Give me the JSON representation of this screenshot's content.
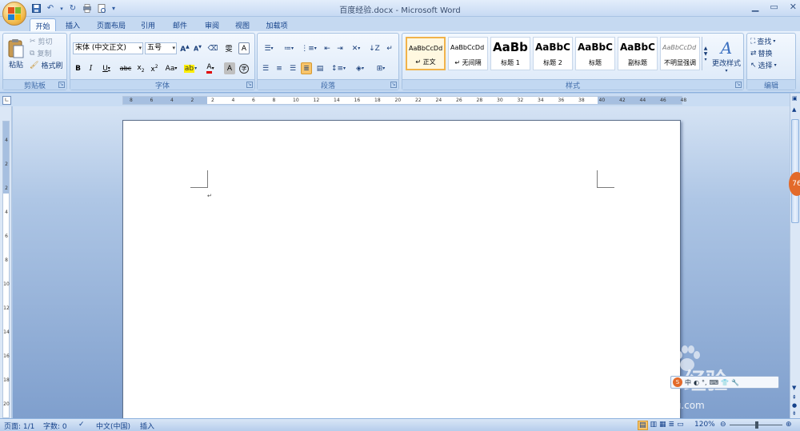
{
  "window": {
    "title": "百度经验.docx - Microsoft Word"
  },
  "tabs": [
    {
      "label": "开始",
      "active": true
    },
    {
      "label": "插入"
    },
    {
      "label": "页面布局"
    },
    {
      "label": "引用"
    },
    {
      "label": "邮件"
    },
    {
      "label": "审阅"
    },
    {
      "label": "视图"
    },
    {
      "label": "加载项"
    }
  ],
  "clipboard": {
    "paste": "粘贴",
    "cut": "剪切",
    "copy": "复制",
    "format_painter": "格式刷",
    "label": "剪贴板"
  },
  "font": {
    "name": "宋体 (中文正文)",
    "size": "五号",
    "label": "字体",
    "aa_label": "Aa"
  },
  "paragraph": {
    "label": "段落"
  },
  "styles": {
    "label": "样式",
    "items": [
      {
        "sample": "AaBbCcDd",
        "name": "↵ 正文",
        "selected": true
      },
      {
        "sample": "AaBbCcDd",
        "name": "↵ 无间隔"
      },
      {
        "sample": "AaBb",
        "name": "标题 1"
      },
      {
        "sample": "AaBbC",
        "name": "标题 2"
      },
      {
        "sample": "AaBbC",
        "name": "标题"
      },
      {
        "sample": "AaBbC",
        "name": "副标题"
      },
      {
        "sample": "AaBbCcDd",
        "name": "不明显强调"
      }
    ],
    "change_styles": "更改样式"
  },
  "editing": {
    "find": "查找",
    "replace": "替换",
    "select": "选择",
    "label": "编辑"
  },
  "document": {
    "cursor_mark": "↵"
  },
  "ruler": {
    "top_numbers": [
      "8",
      "6",
      "4",
      "2",
      "2",
      "4",
      "6",
      "8",
      "10",
      "12",
      "14",
      "16",
      "18",
      "20",
      "22",
      "24",
      "26",
      "28",
      "30",
      "32",
      "34",
      "36",
      "38",
      "40",
      "42",
      "44",
      "46",
      "48"
    ],
    "left_numbers": [
      "4",
      "2",
      "2",
      "4",
      "6",
      "8",
      "10",
      "12",
      "14",
      "16",
      "18",
      "20"
    ]
  },
  "statusbar": {
    "page": "页面: 1/1",
    "words": "字数: 0",
    "language": "中文(中国)",
    "mode": "插入",
    "zoom": "120%"
  },
  "ime": {
    "label": "中"
  },
  "watermark": {
    "brand": "Baidu经验",
    "url": "jingyan.baidu.com"
  },
  "side_bubble": "76"
}
